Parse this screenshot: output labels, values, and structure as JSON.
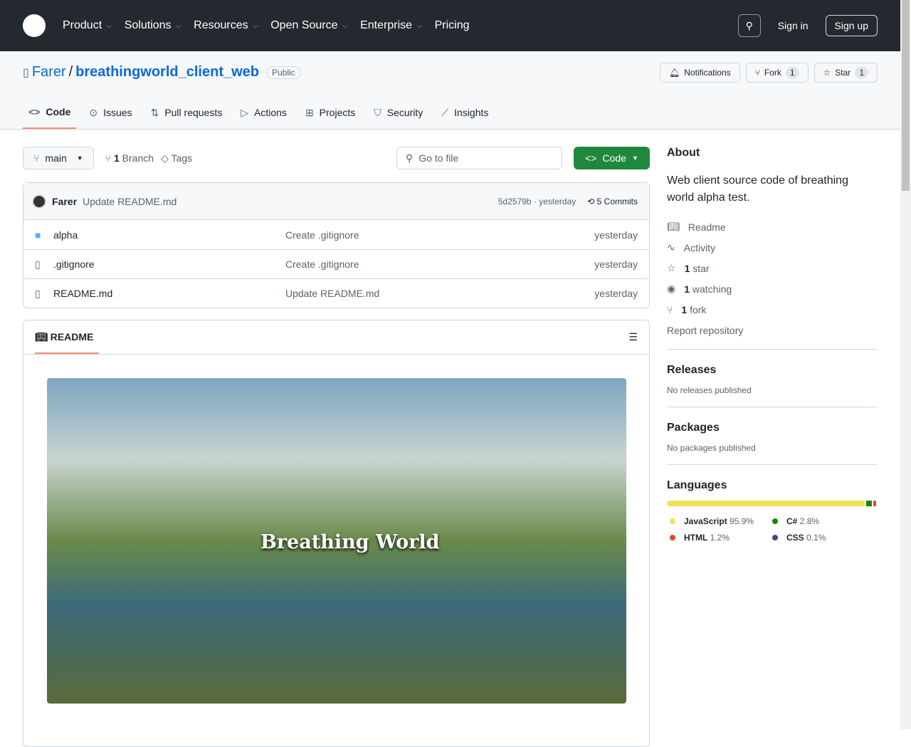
{
  "header": {
    "nav": [
      "Product",
      "Solutions",
      "Resources",
      "Open Source",
      "Enterprise",
      "Pricing"
    ],
    "sign_in": "Sign in",
    "sign_up": "Sign up"
  },
  "repo": {
    "owner": "Farer",
    "name": "breathingworld_client_web",
    "visibility": "Public",
    "notifications": "Notifications",
    "fork": "Fork",
    "fork_count": "1",
    "star": "Star",
    "star_count": "1"
  },
  "tabs": [
    "Code",
    "Issues",
    "Pull requests",
    "Actions",
    "Projects",
    "Security",
    "Insights"
  ],
  "toolbar": {
    "branch": "main",
    "branch_count": "1",
    "branch_label": "Branch",
    "tags": "Tags",
    "go_to_file": "Go to file",
    "code": "Code"
  },
  "commit": {
    "author": "Farer",
    "message": "Update README.md",
    "hash": "5d2579b · yesterday",
    "commits": "5 Commits"
  },
  "files": [
    {
      "name": "alpha",
      "type": "folder",
      "message": "Create .gitignore",
      "time": "yesterday"
    },
    {
      "name": ".gitignore",
      "type": "file",
      "message": "Create .gitignore",
      "time": "yesterday"
    },
    {
      "name": "README.md",
      "type": "file",
      "message": "Update README.md",
      "time": "yesterday"
    }
  ],
  "readme": {
    "title": "README",
    "image_text": "Breathing World"
  },
  "about": {
    "title": "About",
    "description": "Web client source code of breathing world alpha test.",
    "readme": "Readme",
    "activity": "Activity",
    "stars": "1",
    "stars_label": "star",
    "watching": "1",
    "watching_label": "watching",
    "forks": "1",
    "forks_label": "fork",
    "report": "Report repository"
  },
  "releases": {
    "title": "Releases",
    "text": "No releases published"
  },
  "packages": {
    "title": "Packages",
    "text": "No packages published"
  },
  "languages": {
    "title": "Languages",
    "items": [
      {
        "name": "JavaScript",
        "pct": "95.9%",
        "value": 95.9,
        "color": "#f1e05a"
      },
      {
        "name": "C#",
        "pct": "2.8%",
        "value": 2.8,
        "color": "#178600"
      },
      {
        "name": "HTML",
        "pct": "1.2%",
        "value": 1.2,
        "color": "#e34c26"
      },
      {
        "name": "CSS",
        "pct": "0.1%",
        "value": 0.1,
        "color": "#563d7c"
      }
    ]
  }
}
